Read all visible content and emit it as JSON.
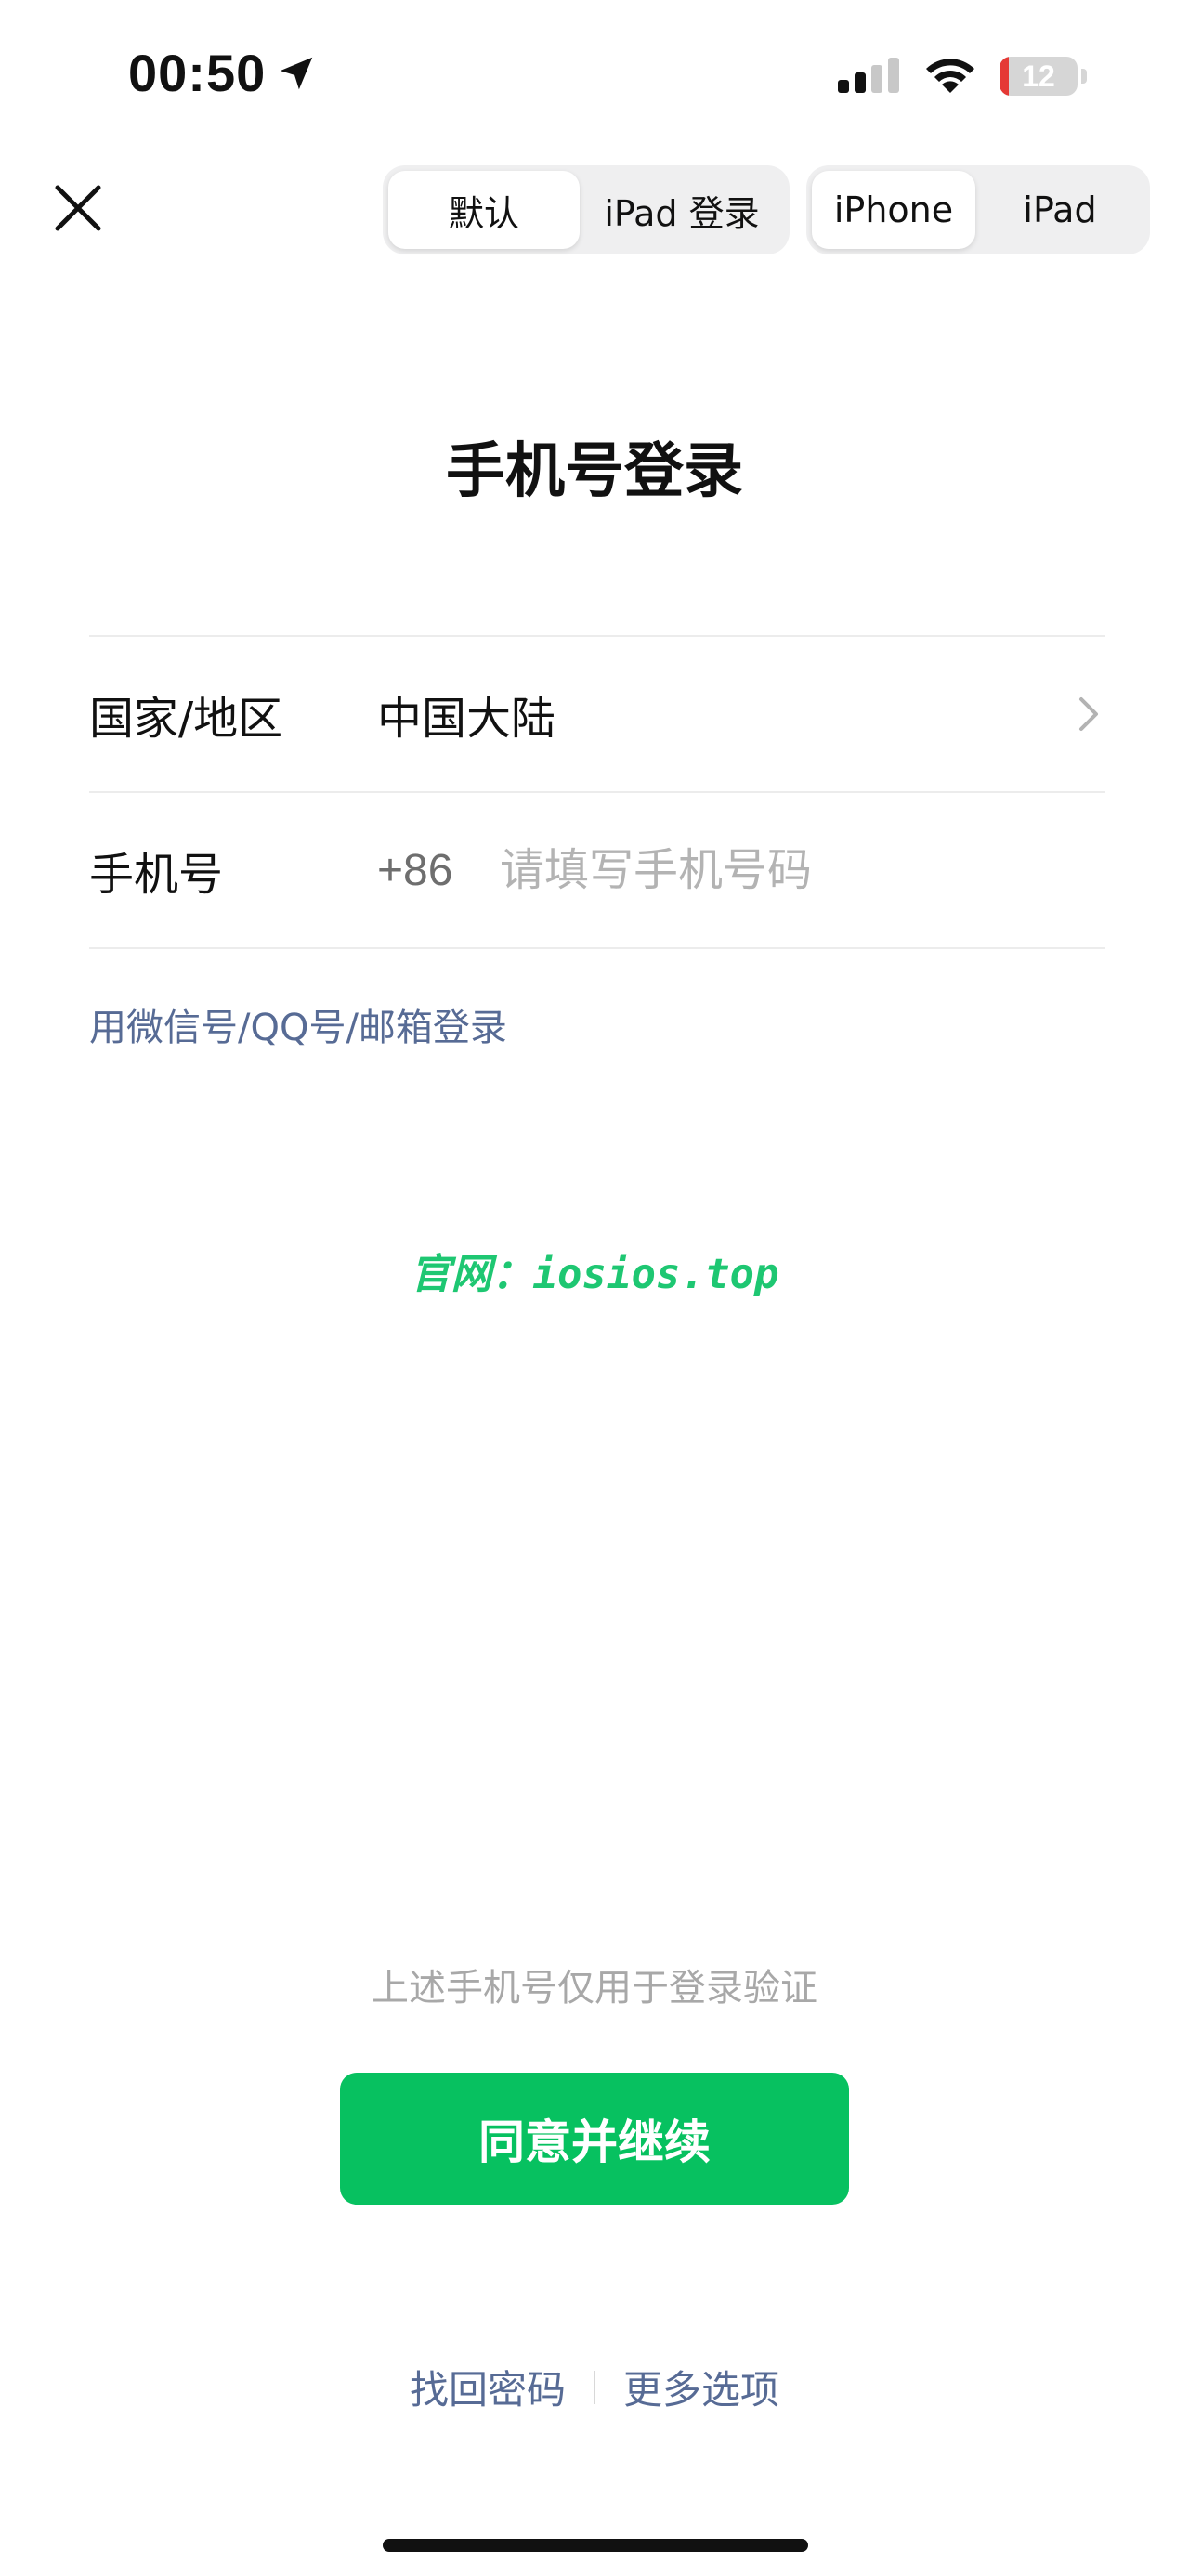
{
  "status_bar": {
    "time": "00:50",
    "battery_level": "12",
    "battery_fraction": 0.12,
    "battery_color": "#e53935"
  },
  "nav": {
    "login_mode": {
      "options": [
        "默认",
        "iPad 登录"
      ],
      "selected": 0
    },
    "device": {
      "options": [
        "iPhone",
        "iPad"
      ],
      "selected": 0
    }
  },
  "title": "手机号登录",
  "form": {
    "region_label": "国家/地区",
    "region_value": "中国大陆",
    "phone_label": "手机号",
    "phone_prefix": "+86",
    "phone_placeholder": "请填写手机号码",
    "phone_value": ""
  },
  "alt_login": "用微信号/QQ号/邮箱登录",
  "watermark": "官网：iosios.top",
  "notice": "上述手机号仅用于登录验证",
  "primary_button": "同意并继续",
  "links": {
    "recover_password": "找回密码",
    "more_options": "更多选项"
  },
  "colors": {
    "accent": "#07c160",
    "link": "#576b95",
    "watermark": "#1ec772"
  },
  "icons": {
    "location": "location-arrow-icon",
    "signal": "cellular-signal-icon",
    "wifi": "wifi-icon",
    "battery": "battery-icon",
    "close": "close-icon",
    "chevron": "chevron-right-icon"
  }
}
